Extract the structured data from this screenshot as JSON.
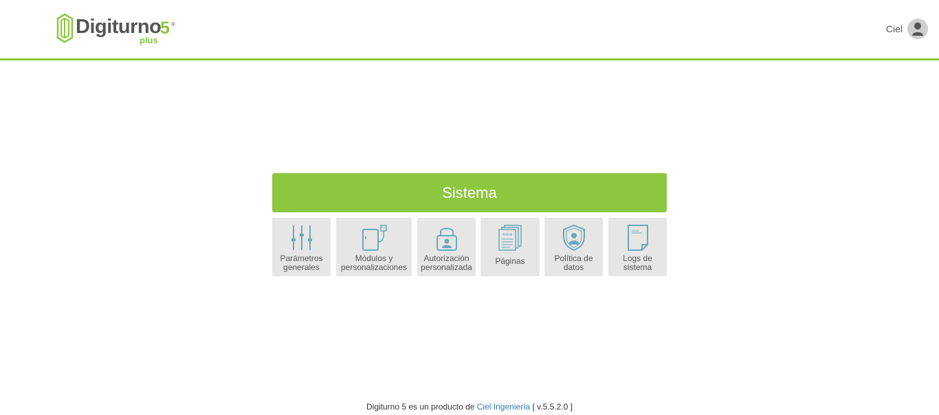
{
  "header": {
    "logo": {
      "brand": "Digiturno",
      "version": "5",
      "registered": "®",
      "edition": "plus"
    },
    "user": {
      "name": "Ciel",
      "avatar_icon": "user-avatar-icon"
    }
  },
  "panel": {
    "title": "Sistema",
    "tiles": [
      {
        "line1": "Parámetros",
        "line2": "generales",
        "icon": "sliders-icon"
      },
      {
        "line1": "Módulos y",
        "line2": "personalizaciones",
        "icon": "tablet-usb-icon"
      },
      {
        "line1": "Autorización",
        "line2": "personalizada",
        "icon": "lock-user-icon"
      },
      {
        "line1": "Páginas",
        "icon": "web-pages-icon"
      },
      {
        "line1": "Política de",
        "line2": "datos",
        "icon": "shield-user-icon"
      },
      {
        "line1": "Logs de",
        "line2": "sistema",
        "icon": "document-icon"
      }
    ]
  },
  "footer": {
    "prefix": "Digiturno 5 es un producto de",
    "company": "Ciel Ingeniería",
    "version": "[ v.5.5.2.0 ]"
  },
  "colors": {
    "accent": "#8dc63f",
    "icon": "#6ba8b8",
    "tile_bg": "#e6e6e6",
    "link": "#2a7ab8"
  }
}
